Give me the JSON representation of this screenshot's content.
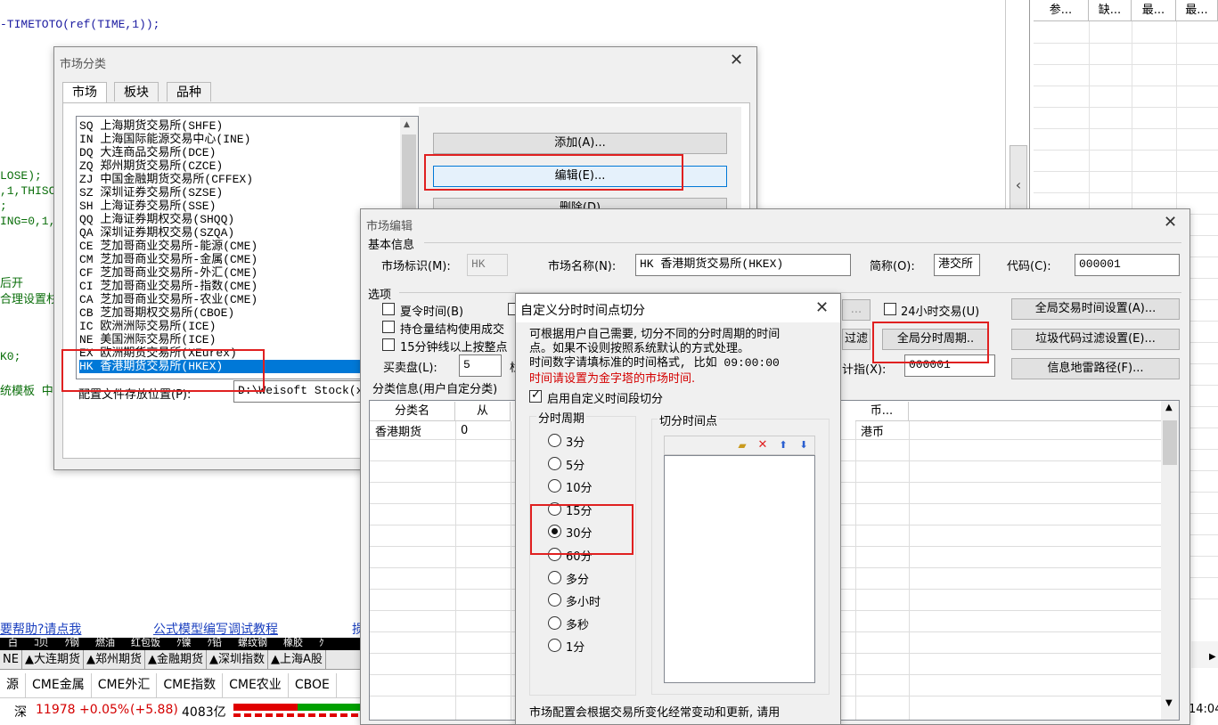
{
  "editor": {
    "code_top": "-TIMETOTO(ref(TIME,1));",
    "frag1": "LOSE);",
    "frag2": ",1,THISC",
    "frag3": ";",
    "frag4": "ING=0,1,",
    "frag5": "后开",
    "frag6": "合理设置杉",
    "frag7": "K0;",
    "frag8": "统模板 中"
  },
  "right_panel": {
    "headers": [
      "参...",
      "缺...",
      "最...",
      "最..."
    ],
    "collapse_arrow": "‹"
  },
  "links": {
    "help": "要帮助?请点我",
    "tutorial": "公式模型编写调试教程",
    "more": "损"
  },
  "bottom": {
    "tabs_row1": [
      "NE",
      "▲大连期货",
      "▲郑州期货",
      "▲金融期货",
      "▲深圳指数",
      "▲上海A股"
    ],
    "tabs_row2": [
      "源",
      "CME金属",
      "CME外汇",
      "CME指数",
      "CME农业",
      "CBOE"
    ],
    "ticker_row": [
      "白",
      "ｺ贝",
      "ｸ钢",
      "燃油",
      "红包饭",
      "ｸ镍",
      "ｸ铅",
      "螺纹钢",
      "橡胶",
      "ｸ"
    ],
    "status_label": "深",
    "status_price": "11978",
    "status_change": "+0.05%",
    "status_change_abs": "(+5.88)",
    "status_volume": "4083亿",
    "time": "14:04"
  },
  "market_dialog": {
    "title": "市场分类",
    "tabs": [
      "市场",
      "板块",
      "品种"
    ],
    "items": [
      "SQ 上海期货交易所(SHFE)",
      "IN 上海国际能源交易中心(INE)",
      "DQ 大连商品交易所(DCE)",
      "ZQ 郑州期货交易所(CZCE)",
      "ZJ 中国金融期货交易所(CFFEX)",
      "SZ 深圳证券交易所(SZSE)",
      "SH 上海证券交易所(SSE)",
      "QQ 上海证券期权交易(SHQQ)",
      "QA 深圳证券期权交易(SZQA)",
      "CE 芝加哥商业交易所-能源(CME)",
      "CM 芝加哥商业交易所-金属(CME)",
      "CF 芝加哥商业交易所-外汇(CME)",
      "CI 芝加哥商业交易所-指数(CME)",
      "CA 芝加哥商业交易所-农业(CME)",
      "CB 芝加哥期权交易所(CBOE)",
      "IC 欧洲洲际交易所(ICE)",
      "NE 美国洲际交易所(ICE)",
      "EX 欧洲期货交易所(XEurex)",
      "HK 香港期货交易所(HKEX)"
    ],
    "selected_index": 18,
    "add_btn": "添加(A)...",
    "edit_btn": "编辑(E)...",
    "delete_btn": "删除(D)",
    "config_label": "配置文件存放位置(P):",
    "config_path": "D:\\Weisoft Stock(x"
  },
  "edit_dialog": {
    "title": "市场编辑",
    "basic_info": "基本信息",
    "market_id_label": "市场标识(M):",
    "market_id": "HK",
    "market_name_label": "市场名称(N):",
    "market_name": "HK 香港期货交易所(HKEX)",
    "short_label": "简称(O):",
    "short_name": "港交所",
    "code_label": "代码(C):",
    "code": "000001",
    "options_label": "选项",
    "dst_label": "夏令时间(B)",
    "position_label": "持仓量结构使用成交",
    "kline15_label": "15分钟线以上按整点",
    "bidask_label": "买卖盘(L):",
    "bidask_value": "5",
    "bidask_suffix": "栏",
    "h24_label": "24小时交易(U)",
    "global_time_btn": "全局交易时间设置(A)...",
    "global_period_btn": "全局分时周期..",
    "filter_partial": "过滤",
    "garbage_btn": "垃圾代码过滤设置(E)...",
    "index_label": "计指(X):",
    "index_value": "000001",
    "info_mine_btn": "信息地雷路径(F)...",
    "category_label": "分类信息(用户自定分类)",
    "grid_headers": [
      "分类名",
      "从",
      "币..."
    ],
    "grid_row": [
      "香港期货",
      "0",
      "港币"
    ],
    "ellipsis_btn": "..."
  },
  "cut_dialog": {
    "title": "自定义分时时间点切分",
    "desc1": "可根据用户自己需要, 切分不同的分时周期的时间",
    "desc2": "点。如果不设则按照系统默认的方式处理。",
    "desc3": "时间数字请填标准的时间格式, 比如 09:00:00",
    "desc_red": "时间请设置为金字塔的市场时间.",
    "enable_label": "启用自定义时间段切分",
    "period_group": "分时周期",
    "periods": [
      "3分",
      "5分",
      "10分",
      "15分",
      "30分",
      "60分",
      "多分",
      "多小时",
      "多秒",
      "1分"
    ],
    "selected_period": "30分",
    "cut_group": "切分时间点",
    "footer": "市场配置会根据交易所变化经常变动和更新, 请用"
  },
  "colors": {
    "highlight": "#0078d7",
    "red_annotation": "#e02020",
    "code_green": "#0a6e0a",
    "link_blue": "#1a3fbf",
    "price_red": "#d40000"
  }
}
